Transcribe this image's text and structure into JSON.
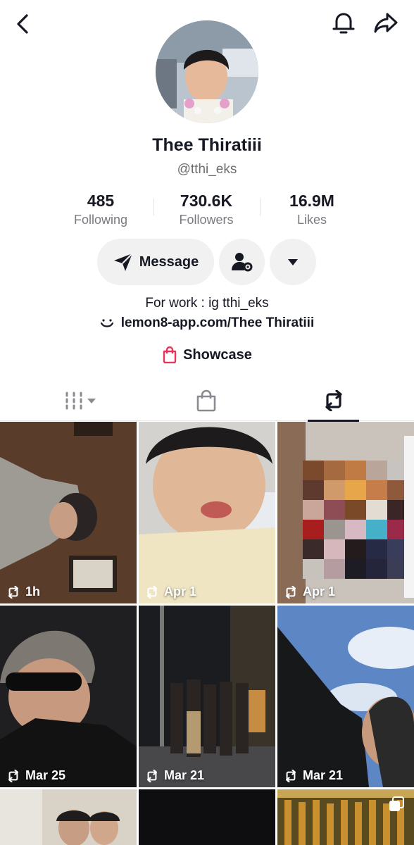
{
  "profile": {
    "display_name": "Thee Thiratiii",
    "username": "@tthi_eks",
    "bio": "For work : ig tthi_eks",
    "link": "lemon8-app.com/Thee Thiratiii",
    "showcase_label": "Showcase"
  },
  "stats": [
    {
      "value": "485",
      "label": "Following"
    },
    {
      "value": "730.6K",
      "label": "Followers"
    },
    {
      "value": "16.9M",
      "label": "Likes"
    }
  ],
  "actions": {
    "message_label": "Message"
  },
  "icons": {
    "back": "chevron-left-icon",
    "notifications": "bell-icon",
    "share": "share-arrow-icon",
    "message": "paper-plane-icon",
    "user_settings": "user-gear-icon",
    "more": "triangle-down-icon",
    "link": "lemon8-smile-icon",
    "showcase": "shopping-bag-icon",
    "tab_videos": "grid-bars-icon",
    "tab_shop": "shopping-bag-icon",
    "tab_reposts": "repost-icon",
    "repost_badge": "repost-icon",
    "multi_image": "stacked-squares-icon"
  },
  "colors": {
    "text": "#161823",
    "secondary_text": "#7a7b80",
    "button_bg": "#f1f1f2",
    "showcase_accent": "#e8345a"
  },
  "posts": [
    {
      "time": "1h"
    },
    {
      "time": "Apr 1"
    },
    {
      "time": "Apr 1"
    },
    {
      "time": "Mar 25"
    },
    {
      "time": "Mar 21"
    },
    {
      "time": "Mar 21"
    },
    {
      "time": ""
    },
    {
      "time": ""
    },
    {
      "time": ""
    }
  ]
}
